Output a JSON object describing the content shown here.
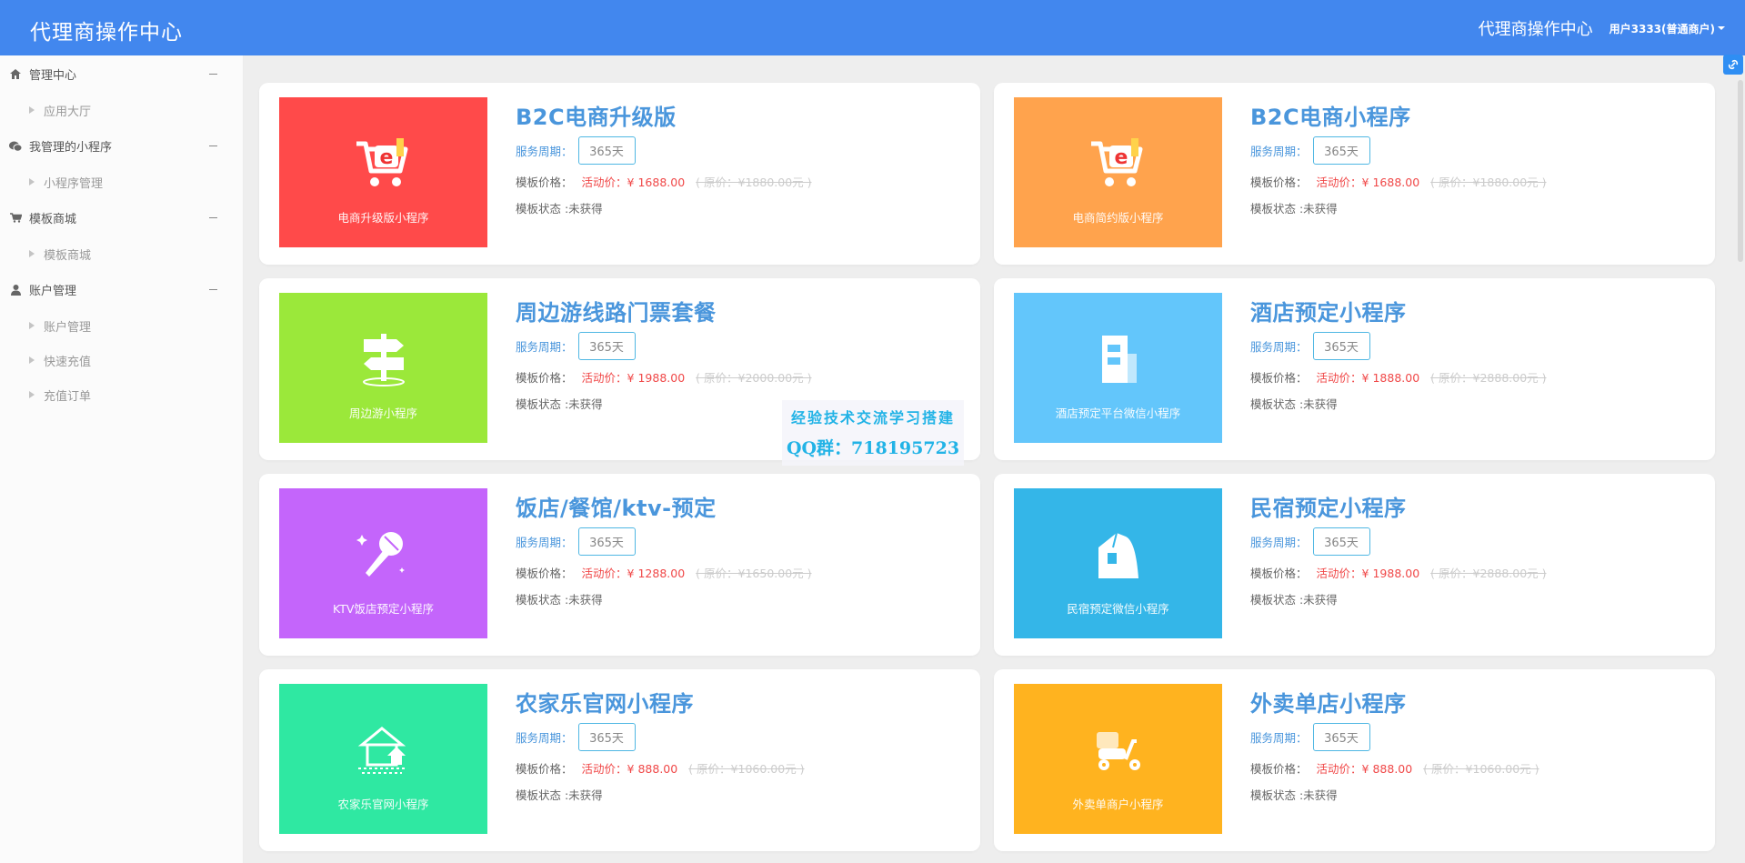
{
  "header": {
    "brand": "代理商操作中心",
    "right_title": "代理商操作中心",
    "user": "用户3333(普通商户)"
  },
  "sidebar": {
    "groups": [
      {
        "label": "管理中心",
        "icon": "home-icon",
        "items": [
          "应用大厅"
        ]
      },
      {
        "label": "我管理的小程序",
        "icon": "wechat-icon",
        "items": [
          "小程序管理"
        ]
      },
      {
        "label": "模板商城",
        "icon": "cart-icon",
        "items": [
          "模板商城"
        ]
      },
      {
        "label": "账户管理",
        "icon": "user-icon",
        "items": [
          "账户管理",
          "快速充值",
          "充值订单"
        ]
      }
    ]
  },
  "labels": {
    "period": "服务周期：",
    "price": "模板价格：",
    "sale_prefix": "活动价：",
    "status": "模板状态 :未获得"
  },
  "products": [
    {
      "title": "B2C电商升级版",
      "thumb_label": "电商升级版小程序",
      "period": "365天",
      "sale_price": "¥ 1688.00",
      "orig_price": "( 原价：¥1880.00元 )",
      "icon": "shopping-cart-e-icon",
      "color": "#ff4a4a"
    },
    {
      "title": "B2C电商小程序",
      "thumb_label": "电商简约版小程序",
      "period": "365天",
      "sale_price": "¥ 1688.00",
      "orig_price": "( 原价：¥1880.00元 )",
      "icon": "shopping-cart-e-icon",
      "color": "#ffa34d"
    },
    {
      "title": "周边游线路门票套餐",
      "thumb_label": "周边游小程序",
      "period": "365天",
      "sale_price": "¥ 1988.00",
      "orig_price": "( 原价：¥2000.00元 )",
      "icon": "signpost-icon",
      "color": "#9be83a"
    },
    {
      "title": "酒店预定小程序",
      "thumb_label": "酒店预定平台微信小程序",
      "period": "365天",
      "sale_price": "¥ 1888.00",
      "orig_price": "( 原价：¥2888.00元 )",
      "icon": "hotel-building-icon",
      "color": "#63c6fb"
    },
    {
      "title": "饭店/餐馆/ktv-预定",
      "thumb_label": "KTV饭店预定小程序",
      "period": "365天",
      "sale_price": "¥ 1288.00",
      "orig_price": "( 原价：¥1650.00元 )",
      "icon": "microphone-icon",
      "color": "#c465fb"
    },
    {
      "title": "民宿预定小程序",
      "thumb_label": "民宿预定微信小程序",
      "period": "365天",
      "sale_price": "¥ 1988.00",
      "orig_price": "( 原价：¥2888.00元 )",
      "icon": "homestay-icon",
      "color": "#34b6e8"
    },
    {
      "title": "农家乐官网小程序",
      "thumb_label": "农家乐官网小程序",
      "period": "365天",
      "sale_price": "¥ 888.00",
      "orig_price": "( 原价：¥1060.00元 )",
      "icon": "farmhouse-icon",
      "color": "#2fe8a2"
    },
    {
      "title": "外卖单店小程序",
      "thumb_label": "外卖单商户小程序",
      "period": "365天",
      "sale_price": "¥ 888.00",
      "orig_price": "( 原价：¥1060.00元 )",
      "icon": "delivery-scooter-icon",
      "color": "#ffb31f"
    }
  ],
  "watermark": {
    "line1": "经验技术交流学习搭建",
    "line2": "QQ群：718195723"
  },
  "edge_widget": {
    "icon": "link-icon"
  }
}
